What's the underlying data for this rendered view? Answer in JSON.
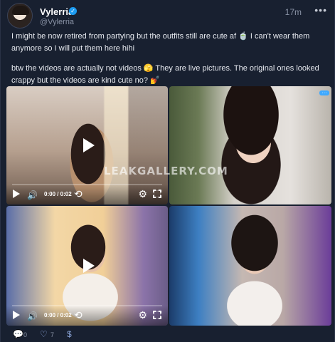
{
  "author": {
    "name": "Vylerria",
    "handle": "@Vylerria",
    "verified_icon": "check-badge-icon"
  },
  "post": {
    "time": "17m",
    "more_label": "•••",
    "paragraph1": "I might be now retired from partying but the outfits still are cute af 🍵 I can't wear them anymore so I will put them here hihi",
    "paragraph2": "btw the videos are actually not videos 🫣 They are live pictures. The original ones looked crappy but the videos are kind cute no? 💅"
  },
  "media": [
    {
      "id": "video-1",
      "type": "video",
      "timecode": "0:00 / 0:02"
    },
    {
      "id": "image-1",
      "type": "image"
    },
    {
      "id": "video-2",
      "type": "video",
      "timecode": "0:00 / 0:02"
    },
    {
      "id": "image-2",
      "type": "image"
    }
  ],
  "watermark": "LEAKGALLERY.COM",
  "corner_badge": "···",
  "footer": {
    "comments": {
      "icon": "comment-icon",
      "count": "0"
    },
    "likes": {
      "icon": "heart-icon",
      "count": "7"
    },
    "tip": {
      "icon": "dollar-icon",
      "label": "$"
    }
  },
  "colors": {
    "background": "#182030",
    "verified": "#1d9bf0",
    "accent": "#8aa3d6"
  }
}
